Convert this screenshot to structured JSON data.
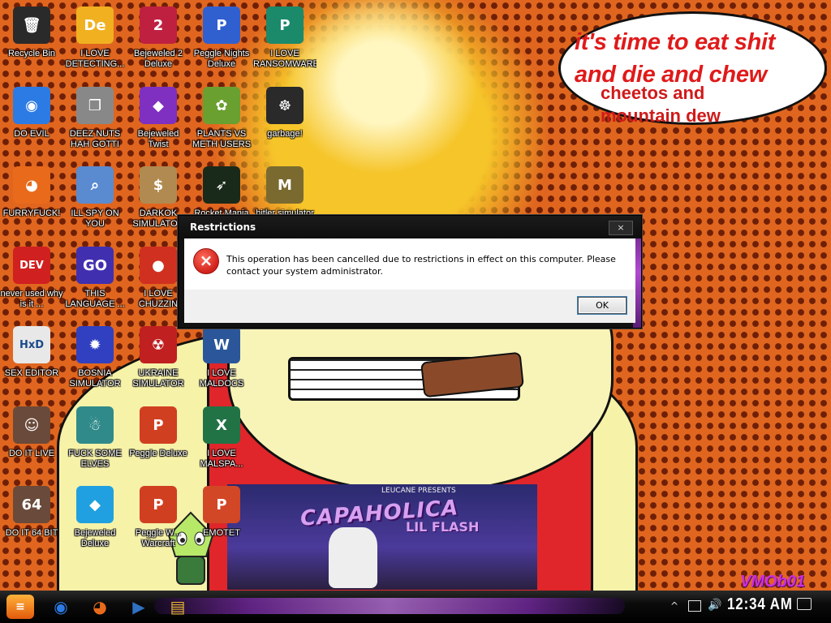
{
  "wallpaper": {
    "speech_bubble": {
      "line1": "it's time to eat shit",
      "line2": "and die and chew",
      "line3": "cheetos and",
      "line4": "mountain dew"
    },
    "album": {
      "title": "CAPAHOLICA",
      "subtitle": "LIL FLASH",
      "sky_text": "LEUCANE PRESENTS"
    },
    "watermark": "VMOb01"
  },
  "desktop_icons": [
    {
      "label": "Recycle Bin",
      "icon": "recycle-bin-icon",
      "color": "#2a2a2a",
      "glyph": "🗑"
    },
    {
      "label": "I LOVE DETECTING...",
      "icon": "detect-it-easy-icon",
      "color": "#f0b020",
      "glyph": "De"
    },
    {
      "label": "Bejeweled 2 Deluxe",
      "icon": "bejeweled-2-icon",
      "color": "#c02040",
      "glyph": "2"
    },
    {
      "label": "Peggle Nights Deluxe",
      "icon": "peggle-nights-icon",
      "color": "#3060d0",
      "glyph": "P"
    },
    {
      "label": "I LOVE RANSOMWARE",
      "icon": "publisher-icon",
      "color": "#1a8a6a",
      "glyph": "P"
    },
    {
      "label": "DO EVIL",
      "icon": "chrome-icon",
      "color": "#2c7be5",
      "glyph": "◉"
    },
    {
      "label": "DEEZ NUTS HAH GOTTI",
      "icon": "windows-stack-icon",
      "color": "#888888",
      "glyph": "❐"
    },
    {
      "label": "Bejeweled Twist",
      "icon": "bejeweled-twist-icon",
      "color": "#8030c0",
      "glyph": "◆"
    },
    {
      "label": "PLANTS VS METH USERS",
      "icon": "plants-vs-zombies-icon",
      "color": "#6aa030",
      "glyph": "✿"
    },
    {
      "label": "garbage!",
      "icon": "lion-emblem-icon",
      "color": "#2a2a2a",
      "glyph": "☸"
    },
    {
      "label": "FURRYFUCK!",
      "icon": "firefox-icon",
      "color": "#e86a1a",
      "glyph": "◕"
    },
    {
      "label": "ILL SPY ON YOU",
      "icon": "network-camera-icon",
      "color": "#5a8ad0",
      "glyph": "⌕"
    },
    {
      "label": "DARKOK SIMULATOR",
      "icon": "money-bag-icon",
      "color": "#b08a50",
      "glyph": "$"
    },
    {
      "label": "Rocket Mania",
      "icon": "rocket-mania-icon",
      "color": "#1a2a1a",
      "glyph": "➶"
    },
    {
      "label": "hitler simulator",
      "icon": "medal-icon",
      "color": "#7a6a30",
      "glyph": "M"
    },
    {
      "label": "never used why is it ...",
      "icon": "dev-cpp-icon",
      "color": "#d02020",
      "glyph": "DEV"
    },
    {
      "label": "THIS LANGUAGE ...",
      "icon": "goland-icon",
      "color": "#4030b0",
      "glyph": "GO"
    },
    {
      "label": "I LOVE CHUZZIN",
      "icon": "chuzzle-icon",
      "color": "#d03020",
      "glyph": "●"
    },
    {
      "label": "SEX EDITOR",
      "icon": "hxd-icon",
      "color": "#e8e8e8",
      "glyph": "HxD"
    },
    {
      "label": "BOSNIA SIMULATOR",
      "icon": "spiked-mine-icon",
      "color": "#3040c0",
      "glyph": "✹"
    },
    {
      "label": "UKRAINE SIMULATOR",
      "icon": "radiation-icon",
      "color": "#c02020",
      "glyph": "☢"
    },
    {
      "label": "I LOVE MALDOCS",
      "icon": "word-icon",
      "color": "#2b579a",
      "glyph": "W"
    },
    {
      "label": "DO IT LIVE",
      "icon": "portrait-icon",
      "color": "#6a4a3a",
      "glyph": "☺"
    },
    {
      "label": "FUCK SOME ELVES",
      "icon": "santa-game-icon",
      "color": "#308a8a",
      "glyph": "☃"
    },
    {
      "label": "Peggle Deluxe",
      "icon": "peggle-deluxe-icon",
      "color": "#d04020",
      "glyph": "P"
    },
    {
      "label": "I LOVE MALSPA...",
      "icon": "excel-icon",
      "color": "#217346",
      "glyph": "X"
    },
    {
      "label": "DO IT 64 BIT",
      "icon": "portrait-64-icon",
      "color": "#6a4a3a",
      "glyph": "64"
    },
    {
      "label": "Bejeweled Deluxe",
      "icon": "bejeweled-deluxe-icon",
      "color": "#20a0e0",
      "glyph": "◆"
    },
    {
      "label": "Peggle W... Warcraft",
      "icon": "peggle-warcraft-icon",
      "color": "#d04020",
      "glyph": "P"
    },
    {
      "label": "EMOTET",
      "icon": "powerpoint-icon",
      "color": "#d24726",
      "glyph": "P"
    }
  ],
  "dialog": {
    "title": "Restrictions",
    "close_label": "×",
    "error_glyph": "×",
    "message": "This operation has been cancelled due to restrictions in effect on this computer. Please contact your system administrator.",
    "ok_label": "OK"
  },
  "taskbar": {
    "start_glyph": "≡",
    "pinned": [
      {
        "name": "chrome-taskbar-button",
        "icon": "chrome-icon",
        "glyph": "◉",
        "color": "#2c7be5"
      },
      {
        "name": "firefox-taskbar-button",
        "icon": "firefox-icon",
        "glyph": "◕",
        "color": "#e86a1a"
      },
      {
        "name": "media-taskbar-button",
        "icon": "media-player-icon",
        "glyph": "▶",
        "color": "#3070c0"
      },
      {
        "name": "explorer-taskbar-button",
        "icon": "file-explorer-icon",
        "glyph": "▤",
        "color": "#e8b830"
      }
    ],
    "tray_chevron": "^",
    "volume_glyph": "🔊",
    "clock": "12:34 AM"
  }
}
